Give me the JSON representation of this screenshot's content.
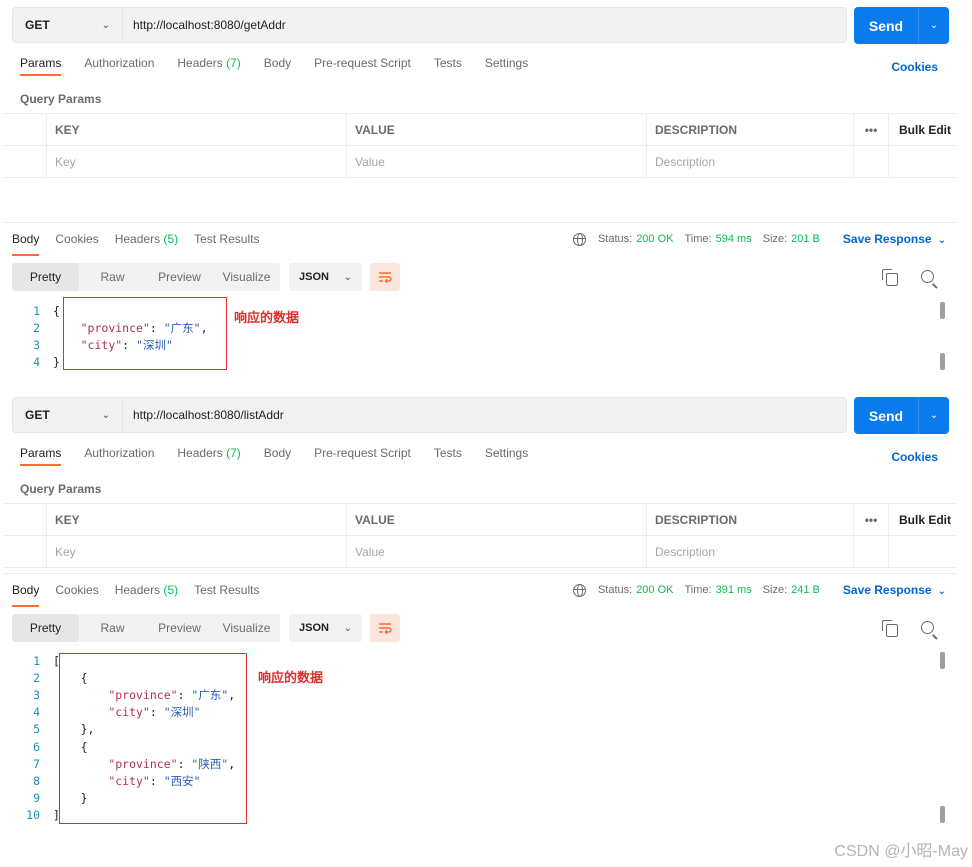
{
  "requests": [
    {
      "method": "GET",
      "url": "http://localhost:8080/getAddr",
      "send_label": "Send",
      "tabs": [
        {
          "label": "Params",
          "count": ""
        },
        {
          "label": "Authorization",
          "count": ""
        },
        {
          "label": "Headers",
          "count": "(7)"
        },
        {
          "label": "Body",
          "count": ""
        },
        {
          "label": "Pre-request Script",
          "count": ""
        },
        {
          "label": "Tests",
          "count": ""
        },
        {
          "label": "Settings",
          "count": ""
        }
      ],
      "cookies_label": "Cookies",
      "query_params_title": "Query Params",
      "table_headers": {
        "key": "KEY",
        "value": "VALUE",
        "description": "DESCRIPTION",
        "more": "•••",
        "bulk_edit": "Bulk Edit"
      },
      "placeholders": {
        "key": "Key",
        "value": "Value",
        "description": "Description"
      },
      "response": {
        "tabs": [
          {
            "label": "Body",
            "count": ""
          },
          {
            "label": "Cookies",
            "count": ""
          },
          {
            "label": "Headers",
            "count": "(5)"
          },
          {
            "label": "Test Results",
            "count": ""
          }
        ],
        "status_label": "Status:",
        "status": "200 OK",
        "time_label": "Time:",
        "time": "594 ms",
        "size_label": "Size:",
        "size": "201 B",
        "save_response": "Save Response",
        "view_modes": [
          "Pretty",
          "Raw",
          "Preview",
          "Visualize"
        ],
        "format": "JSON",
        "annotation": "响应的数据",
        "lines": [
          {
            "num": "1",
            "indent": "",
            "parts": [
              {
                "t": "p",
                "v": "{"
              }
            ]
          },
          {
            "num": "2",
            "indent": "    ",
            "parts": [
              {
                "t": "k",
                "v": "\"province\""
              },
              {
                "t": "p",
                "v": ": "
              },
              {
                "t": "s",
                "v": "\"广东\""
              },
              {
                "t": "p",
                "v": ","
              }
            ]
          },
          {
            "num": "3",
            "indent": "    ",
            "parts": [
              {
                "t": "k",
                "v": "\"city\""
              },
              {
                "t": "p",
                "v": ": "
              },
              {
                "t": "s",
                "v": "\"深圳\""
              }
            ]
          },
          {
            "num": "4",
            "indent": "",
            "parts": [
              {
                "t": "p",
                "v": "}"
              }
            ]
          }
        ]
      }
    },
    {
      "method": "GET",
      "url": "http://localhost:8080/listAddr",
      "send_label": "Send",
      "tabs": [
        {
          "label": "Params",
          "count": ""
        },
        {
          "label": "Authorization",
          "count": ""
        },
        {
          "label": "Headers",
          "count": "(7)"
        },
        {
          "label": "Body",
          "count": ""
        },
        {
          "label": "Pre-request Script",
          "count": ""
        },
        {
          "label": "Tests",
          "count": ""
        },
        {
          "label": "Settings",
          "count": ""
        }
      ],
      "cookies_label": "Cookies",
      "query_params_title": "Query Params",
      "table_headers": {
        "key": "KEY",
        "value": "VALUE",
        "description": "DESCRIPTION",
        "more": "•••",
        "bulk_edit": "Bulk Edit"
      },
      "placeholders": {
        "key": "Key",
        "value": "Value",
        "description": "Description"
      },
      "response": {
        "tabs": [
          {
            "label": "Body",
            "count": ""
          },
          {
            "label": "Cookies",
            "count": ""
          },
          {
            "label": "Headers",
            "count": "(5)"
          },
          {
            "label": "Test Results",
            "count": ""
          }
        ],
        "status_label": "Status:",
        "status": "200 OK",
        "time_label": "Time:",
        "time": "391 ms",
        "size_label": "Size:",
        "size": "241 B",
        "save_response": "Save Response",
        "view_modes": [
          "Pretty",
          "Raw",
          "Preview",
          "Visualize"
        ],
        "format": "JSON",
        "annotation": "响应的数据",
        "lines": [
          {
            "num": "1",
            "indent": "",
            "parts": [
              {
                "t": "p",
                "v": "["
              }
            ]
          },
          {
            "num": "2",
            "indent": "    ",
            "parts": [
              {
                "t": "p",
                "v": "{"
              }
            ]
          },
          {
            "num": "3",
            "indent": "        ",
            "parts": [
              {
                "t": "k",
                "v": "\"province\""
              },
              {
                "t": "p",
                "v": ": "
              },
              {
                "t": "s",
                "v": "\"广东\""
              },
              {
                "t": "p",
                "v": ","
              }
            ]
          },
          {
            "num": "4",
            "indent": "        ",
            "parts": [
              {
                "t": "k",
                "v": "\"city\""
              },
              {
                "t": "p",
                "v": ": "
              },
              {
                "t": "s",
                "v": "\"深圳\""
              }
            ]
          },
          {
            "num": "5",
            "indent": "    ",
            "parts": [
              {
                "t": "p",
                "v": "},"
              }
            ]
          },
          {
            "num": "6",
            "indent": "    ",
            "parts": [
              {
                "t": "p",
                "v": "{"
              }
            ]
          },
          {
            "num": "7",
            "indent": "        ",
            "parts": [
              {
                "t": "k",
                "v": "\"province\""
              },
              {
                "t": "p",
                "v": ": "
              },
              {
                "t": "s",
                "v": "\"陕西\""
              },
              {
                "t": "p",
                "v": ","
              }
            ]
          },
          {
            "num": "8",
            "indent": "        ",
            "parts": [
              {
                "t": "k",
                "v": "\"city\""
              },
              {
                "t": "p",
                "v": ": "
              },
              {
                "t": "s",
                "v": "\"西安\""
              }
            ]
          },
          {
            "num": "9",
            "indent": "    ",
            "parts": [
              {
                "t": "p",
                "v": "}"
              }
            ]
          },
          {
            "num": "10",
            "indent": "",
            "parts": [
              {
                "t": "p",
                "v": "]"
              }
            ]
          }
        ]
      }
    }
  ],
  "watermark": "CSDN @小昭-May",
  "colors": {
    "accent": "#ff6c37",
    "send": "#097bed",
    "link": "#0265d2",
    "success": "#0cbb52",
    "annotation": "#e02e2e"
  }
}
